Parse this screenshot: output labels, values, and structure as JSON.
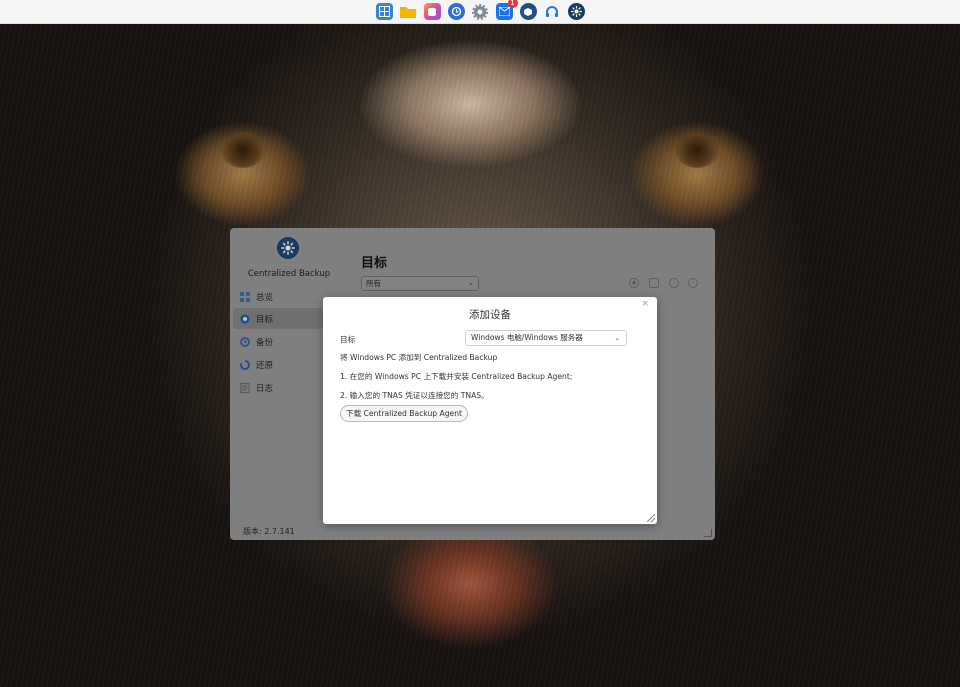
{
  "taskbar": {
    "icons": [
      {
        "name": "control-panel-icon",
        "color": "#3b82d6"
      },
      {
        "name": "file-manager-icon",
        "color": "#f5b400"
      },
      {
        "name": "photos-icon",
        "color": "#d64aa8"
      },
      {
        "name": "snapshot-icon",
        "color": "#2d6fd2"
      },
      {
        "name": "settings-icon",
        "color": "#7d8a96"
      },
      {
        "name": "app-center-icon",
        "color": "#1e73e8",
        "badge": "1"
      },
      {
        "name": "docker-icon",
        "color": "#1f4f86"
      },
      {
        "name": "support-icon",
        "color": "#2479d8"
      },
      {
        "name": "centralized-backup-icon",
        "color": "#1a3a5e"
      }
    ]
  },
  "app": {
    "name": "Centralized Backup",
    "title": "目标",
    "filter_value": "所有",
    "version": "版本: 2.7.141",
    "nav": [
      {
        "label": "总览",
        "icon": "overview-icon",
        "color": "#2f6fbf",
        "active": false
      },
      {
        "label": "目标",
        "icon": "target-icon",
        "color": "#1e5fae",
        "active": true
      },
      {
        "label": "备份",
        "icon": "backup-icon",
        "color": "#1e5fae",
        "active": false
      },
      {
        "label": "还原",
        "icon": "restore-icon",
        "color": "#1e5fae",
        "active": false
      },
      {
        "label": "日志",
        "icon": "log-icon",
        "color": "#666666",
        "active": false
      }
    ],
    "toolbar": [
      "add-icon",
      "edit-icon",
      "refresh-icon",
      "delete-icon"
    ]
  },
  "modal": {
    "title": "添加设备",
    "close": "×",
    "target_label": "目标",
    "target_value": "Windows 电脑/Windows 服务器",
    "intro": "将 Windows PC 添加到 Centralized Backup",
    "step1": "1. 在您的 Windows PC 上下载并安装 Centralized Backup Agent;",
    "step2": "2. 输入您的 TNAS 凭证以连接您的 TNAS。",
    "download_button": "下载 Centralized Backup Agent"
  }
}
